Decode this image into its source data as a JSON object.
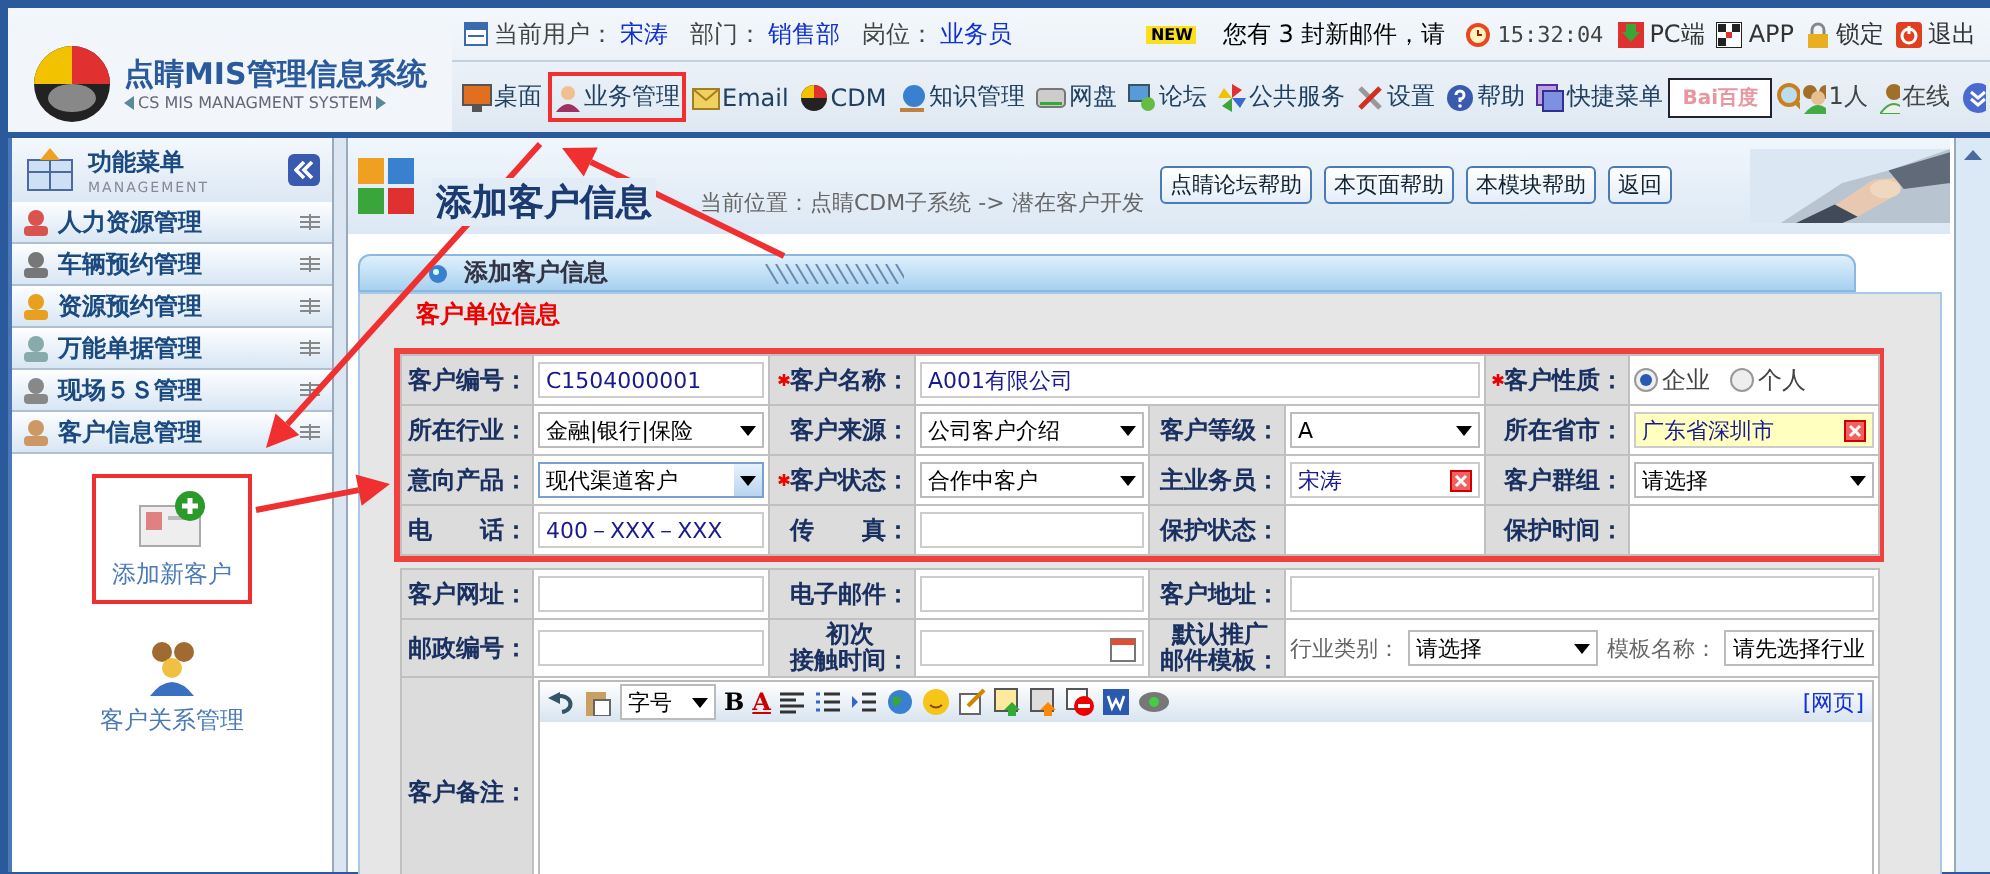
{
  "header": {
    "logo_title": "点睛MIS管理信息系统",
    "logo_subtitle": "CS MIS MANAGMENT SYSTEM",
    "user_label": "当前用户：",
    "user": "宋涛",
    "dept_label": "部门：",
    "dept": "销售部",
    "post_label": "岗位：",
    "post": "业务员",
    "new_badge": "NEW",
    "notice": "您有 3 封新邮件，请",
    "time": "15:32:04",
    "actions": [
      "PC端",
      "APP",
      "锁定",
      "退出"
    ],
    "nav": [
      {
        "label": "桌面",
        "highlighted": false
      },
      {
        "label": "业务管理",
        "highlighted": true
      },
      {
        "label": "Email",
        "highlighted": false
      },
      {
        "label": "CDM",
        "highlighted": false
      },
      {
        "label": "知识管理",
        "highlighted": false
      },
      {
        "label": "网盘",
        "highlighted": false
      },
      {
        "label": "论坛",
        "highlighted": false
      },
      {
        "label": "公共服务",
        "highlighted": false
      },
      {
        "label": "设置",
        "highlighted": false
      },
      {
        "label": "帮助",
        "highlighted": false
      },
      {
        "label": "快捷菜单",
        "highlighted": false
      }
    ],
    "search_logo": "Bai百度",
    "online_count": "1人",
    "online": "在线"
  },
  "sidebar": {
    "title": "功能菜单",
    "subtitle": "MANAGEMENT",
    "items": [
      {
        "label": "人力资源管理"
      },
      {
        "label": "车辆预约管理"
      },
      {
        "label": "资源预约管理"
      },
      {
        "label": "万能单据管理"
      },
      {
        "label": "现场５Ｓ管理"
      },
      {
        "label": "客户信息管理",
        "children": [
          {
            "label": "添加新客户",
            "highlighted": true
          },
          {
            "label": "客户关系管理",
            "highlighted": false
          }
        ]
      }
    ]
  },
  "page": {
    "title": "添加客户信息",
    "breadcrumb": "当前位置：点睛CDM子系统 -> 潜在客户开发",
    "buttons": [
      "点睛论坛帮助",
      "本页面帮助",
      "本模块帮助",
      "返回"
    ]
  },
  "panel": {
    "tab": "添加客户信息",
    "section": "客户单位信息",
    "groups": [
      {
        "highlighted": true,
        "rows": [
          [
            {
              "label": "客户编号：",
              "required": false,
              "kind": "text",
              "value": "C1504000001"
            },
            {
              "label": "客户名称：",
              "required": true,
              "kind": "long_text",
              "value": "A001有限公司"
            },
            "",
            {
              "label": "客户性质：",
              "required": true,
              "kind": "radio",
              "options": [
                {
                  "label": "企业",
                  "selected": true
                },
                {
                  "label": "个人",
                  "selected": false
                }
              ]
            }
          ],
          [
            {
              "label": "所在行业：",
              "required": false,
              "kind": "select",
              "value": "金融|银行|保险",
              "focused": false
            },
            {
              "label": "客户来源：",
              "required": false,
              "kind": "select",
              "value": "公司客户介绍",
              "focused": false
            },
            {
              "label": "客户等级：",
              "required": false,
              "kind": "select",
              "value": "A",
              "focused": false
            },
            {
              "label": "所在省市：",
              "required": false,
              "kind": "picker",
              "value": "广东省深圳市",
              "highlighted": true
            }
          ],
          [
            {
              "label": "意向产品：",
              "required": false,
              "kind": "select",
              "value": "现代渠道客户",
              "focused": true
            },
            {
              "label": "客户状态：",
              "required": true,
              "kind": "select",
              "value": "合作中客户",
              "focused": false
            },
            {
              "label": "主业务员：",
              "required": false,
              "kind": "picker",
              "value": "宋涛",
              "highlighted": false
            },
            {
              "label": "客户群组：",
              "required": false,
              "kind": "select",
              "value": "请选择",
              "focused": false
            }
          ],
          [
            {
              "label": "电　　话：",
              "required": false,
              "kind": "text",
              "value": "400－XXX－XXX"
            },
            {
              "label": "传　　真：",
              "required": false,
              "kind": "text"
            },
            {
              "label": "保护状态：",
              "required": false,
              "kind": "static"
            },
            {
              "label": "保护时间：",
              "required": false,
              "kind": "static"
            }
          ]
        ]
      },
      {
        "highlighted": false,
        "rows": [
          [
            {
              "label": "客户网址：",
              "required": false,
              "kind": "text"
            },
            {
              "label": "电子邮件：",
              "required": false,
              "kind": "text"
            },
            {
              "label": "客户地址：",
              "required": false,
              "kind": "long_text"
            }
          ],
          [
            {
              "label": "邮政编号：",
              "required": false,
              "kind": "text"
            },
            {
              "label": [
                "初次",
                "接触时间："
              ],
              "required": false,
              "kind": "date"
            },
            {
              "label": [
                "默认推广",
                "邮件模板："
              ],
              "required": false,
              "kind": "template",
              "category_label": "行业类别：",
              "category": "请选择",
              "template_label": "模板名称：",
              "template": "请先选择行业"
            }
          ],
          [
            {
              "label": "客户备注：",
              "required": false,
              "kind": "editor",
              "font_size": "字号",
              "tools": [
                "B",
                "A"
              ],
              "mode": "[网页]"
            }
          ]
        ]
      }
    ]
  }
}
